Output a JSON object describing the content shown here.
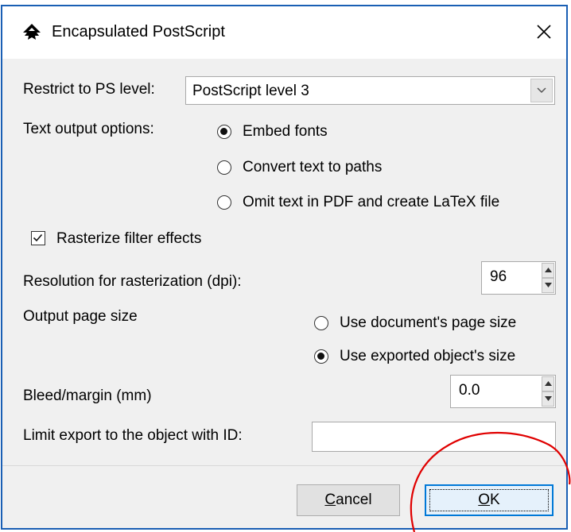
{
  "dialog": {
    "title": "Encapsulated PostScript",
    "close_glyph": "✕",
    "icon": "inkscape-logo-icon"
  },
  "ps_level": {
    "label": "Restrict to PS level:",
    "selected": "PostScript level 3"
  },
  "text_output": {
    "label": "Text output options:",
    "options": [
      {
        "label": "Embed fonts",
        "checked": true
      },
      {
        "label": "Convert text to paths",
        "checked": false
      },
      {
        "label": "Omit text in PDF and create LaTeX file",
        "checked": false
      }
    ]
  },
  "rasterize": {
    "label": "Rasterize filter effects",
    "checked": true
  },
  "resolution": {
    "label": "Resolution for rasterization (dpi):",
    "value": "96"
  },
  "page_size": {
    "label": "Output page size",
    "options": [
      {
        "label": "Use document's page size",
        "checked": false
      },
      {
        "label": "Use exported object's size",
        "checked": true
      }
    ]
  },
  "bleed": {
    "label": "Bleed/margin (mm)",
    "value": "0.0"
  },
  "limit_export": {
    "label": "Limit export to the object with ID:",
    "value": ""
  },
  "buttons": {
    "cancel": {
      "label": "Cancel",
      "mnemonic": "C",
      "rest": "ancel"
    },
    "ok": {
      "label": "OK",
      "mnemonic": "O",
      "rest": "K"
    }
  },
  "colors": {
    "accent": "#0078d7",
    "annotation": "#e00000",
    "window_border": "#1a5fb4"
  }
}
